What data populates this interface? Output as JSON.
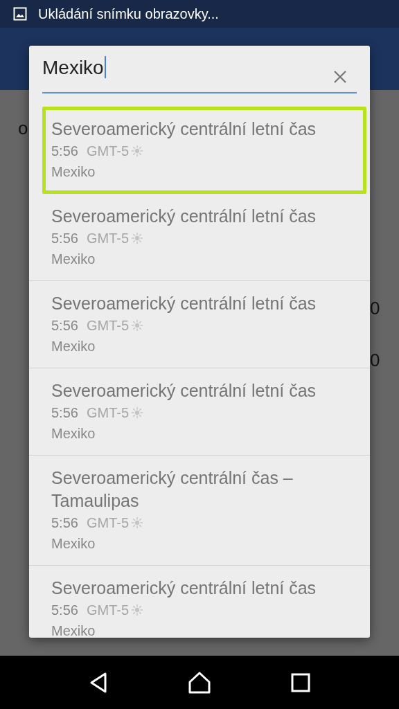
{
  "status_bar": {
    "notification": "Ukládání snímku obrazovky..."
  },
  "background": {
    "fragments": [
      {
        "kind": "left",
        "text": "o"
      },
      {
        "kind": "right",
        "text": "0"
      },
      {
        "kind": "right",
        "text": "0"
      }
    ]
  },
  "dialog": {
    "search": {
      "value": "Mexiko"
    },
    "results": [
      {
        "title": "Severoamerický centrální letní čas",
        "time": "5:56",
        "offset": "GMT-5",
        "country": "Mexiko",
        "selected": true
      },
      {
        "title": "Severoamerický centrální letní čas",
        "time": "5:56",
        "offset": "GMT-5",
        "country": "Mexiko",
        "selected": false
      },
      {
        "title": "Severoamerický centrální letní čas",
        "time": "5:56",
        "offset": "GMT-5",
        "country": "Mexiko",
        "selected": false
      },
      {
        "title": "Severoamerický centrální letní čas",
        "time": "5:56",
        "offset": "GMT-5",
        "country": "Mexiko",
        "selected": false
      },
      {
        "title": "Severoamerický centrální čas – Tamaulipas",
        "time": "5:56",
        "offset": "GMT-5",
        "country": "Mexiko",
        "selected": false
      },
      {
        "title": "Severoamerický centrální letní čas",
        "time": "5:56",
        "offset": "GMT-5",
        "country": "Mexiko",
        "selected": false
      }
    ]
  }
}
